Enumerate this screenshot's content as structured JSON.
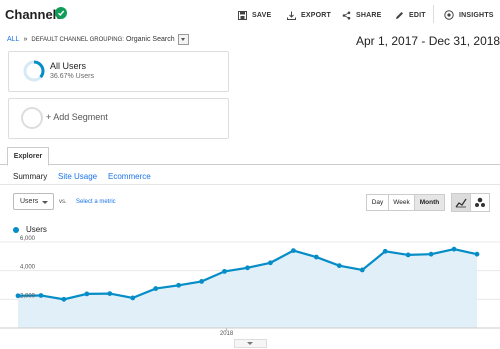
{
  "header": {
    "title": "Channels",
    "actions": [
      {
        "label": "SAVE",
        "icon": "save-icon"
      },
      {
        "label": "EXPORT",
        "icon": "export-icon"
      },
      {
        "label": "SHARE",
        "icon": "share-icon"
      },
      {
        "label": "EDIT",
        "icon": "edit-icon"
      },
      {
        "label": "INSIGHTS",
        "icon": "insights-icon"
      }
    ]
  },
  "breadcrumb": {
    "all": "ALL",
    "separator": "»",
    "grouping": "DEFAULT CHANNEL GROUPING:",
    "value": "Organic Search"
  },
  "date_range": "Apr 1, 2017 - Dec 31, 2018",
  "segments": {
    "active": {
      "name": "All Users",
      "share": "36.67% Users",
      "fraction": 0.3667
    },
    "add_label": "+ Add Segment"
  },
  "explorer": {
    "tab": "Explorer",
    "subtabs": [
      "Summary",
      "Site Usage",
      "Ecommerce"
    ],
    "metric": "Users",
    "vs": "vs.",
    "select_metric": "Select a metric",
    "granularity": [
      "Day",
      "Week",
      "Month"
    ],
    "granularity_selected": "Month"
  },
  "colors": {
    "accent": "#058dc7",
    "link": "#1a73e8",
    "fill": "#e1f0f8"
  },
  "chart_data": {
    "type": "area",
    "series": [
      {
        "name": "Users",
        "values": [
          2250,
          2270,
          2000,
          2380,
          2400,
          2100,
          2750,
          2980,
          3250,
          3950,
          4200,
          4550,
          5400,
          4950,
          4350,
          4050,
          5350,
          5100,
          5150,
          5500,
          5150
        ]
      }
    ],
    "x_labels": [
      "2018"
    ],
    "x_label_index": 9,
    "y_ticks": [
      "2,000",
      "4,000",
      "6,000"
    ],
    "y_tick_values": [
      2000,
      4000,
      6000
    ],
    "ylim": [
      0,
      6000
    ]
  }
}
